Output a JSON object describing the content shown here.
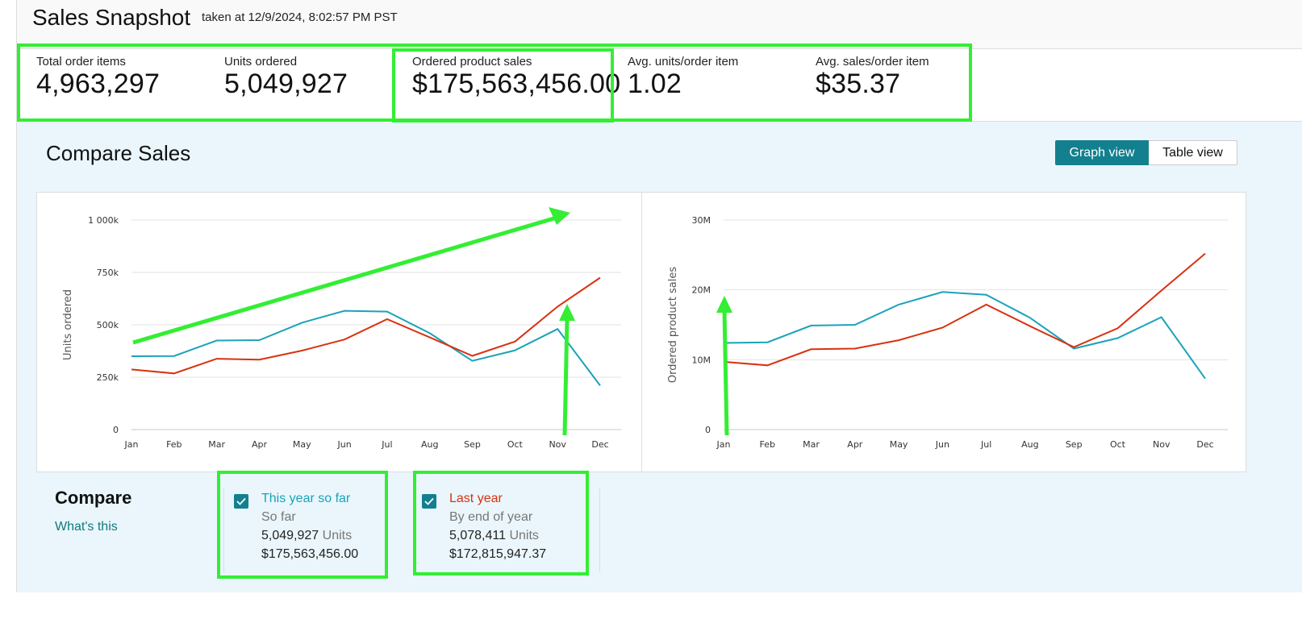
{
  "header": {
    "title": "Sales Snapshot",
    "timestamp": "taken at 12/9/2024, 8:02:57 PM PST"
  },
  "metrics": [
    {
      "label": "Total order items",
      "value": "4,963,297"
    },
    {
      "label": "Units ordered",
      "value": "5,049,927"
    },
    {
      "label": "Ordered product sales",
      "value": "$175,563,456.00"
    },
    {
      "label": "Avg. units/order item",
      "value": "1.02"
    },
    {
      "label": "Avg. sales/order item",
      "value": "$35.37"
    }
  ],
  "compare_section": {
    "title": "Compare Sales",
    "graph_view_label": "Graph view",
    "table_view_label": "Table view",
    "active_view": "Graph view"
  },
  "colors": {
    "this_year": "#1aa3b8",
    "last_year": "#d9320f",
    "accent": "#13808f",
    "annotation": "#33ee33"
  },
  "chart_data": [
    {
      "type": "line",
      "ylabel": "Units ordered",
      "categories": [
        "Jan",
        "Feb",
        "Mar",
        "Apr",
        "May",
        "Jun",
        "Jul",
        "Aug",
        "Sep",
        "Oct",
        "Nov",
        "Dec"
      ],
      "y_ticks": [
        0,
        250000,
        500000,
        750000,
        1000000
      ],
      "y_tick_labels": [
        "0",
        "250k",
        "500k",
        "750k",
        "1 000k"
      ],
      "ylim": [
        0,
        1000000
      ],
      "grid": true,
      "series": [
        {
          "name": "This year so far",
          "color_key": "this_year",
          "values": [
            350000,
            351000,
            425000,
            427000,
            510000,
            567000,
            563000,
            460000,
            328000,
            378000,
            480000,
            210000
          ]
        },
        {
          "name": "Last year",
          "color_key": "last_year",
          "values": [
            287000,
            268000,
            338000,
            334000,
            377000,
            430000,
            527000,
            440000,
            352000,
            420000,
            587000,
            725000
          ]
        }
      ]
    },
    {
      "type": "line",
      "ylabel": "Ordered product sales",
      "categories": [
        "Jan",
        "Feb",
        "Mar",
        "Apr",
        "May",
        "Jun",
        "Jul",
        "Aug",
        "Sep",
        "Oct",
        "Nov",
        "Dec"
      ],
      "y_ticks": [
        0,
        10000000,
        20000000,
        30000000
      ],
      "y_tick_labels": [
        "0",
        "10M",
        "20M",
        "30M"
      ],
      "ylim": [
        0,
        30000000
      ],
      "grid": true,
      "series": [
        {
          "name": "This year so far",
          "color_key": "this_year",
          "values": [
            12400000,
            12500000,
            14900000,
            15000000,
            17900000,
            19700000,
            19300000,
            16000000,
            11600000,
            13100000,
            16100000,
            7300000
          ]
        },
        {
          "name": "Last year",
          "color_key": "last_year",
          "values": [
            9700000,
            9200000,
            11500000,
            11600000,
            12800000,
            14600000,
            17900000,
            14800000,
            11800000,
            14500000,
            19900000,
            25200000
          ]
        }
      ]
    }
  ],
  "compare_legend": {
    "heading": "Compare",
    "whats_this": "What's this",
    "items": [
      {
        "name": "This year so far",
        "sub": "So far",
        "units_value": "5,049,927",
        "units_label": "Units",
        "sales": "$175,563,456.00",
        "checked": true
      },
      {
        "name": "Last year",
        "sub": "By end of year",
        "units_value": "5,078,411",
        "units_label": "Units",
        "sales": "$172,815,947.37",
        "checked": true
      }
    ]
  }
}
